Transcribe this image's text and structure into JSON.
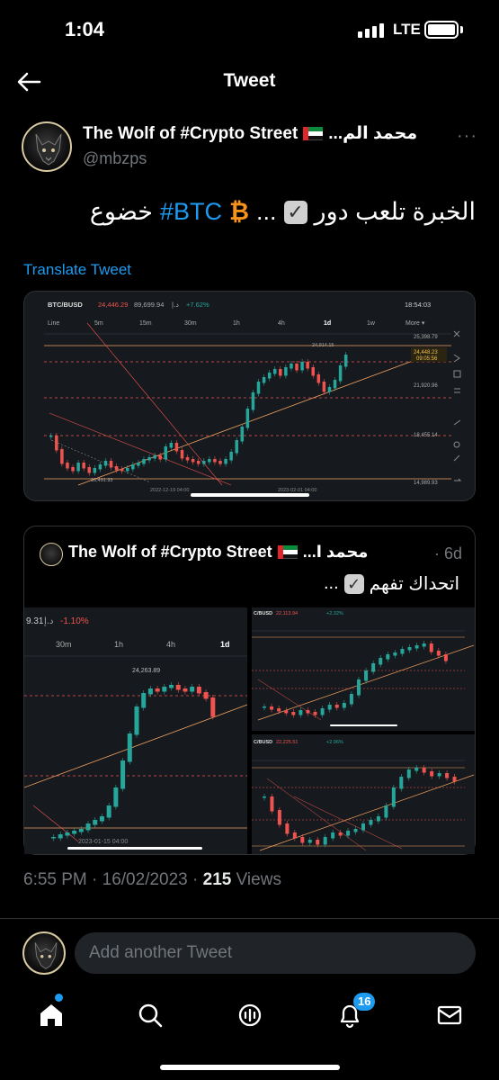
{
  "status_bar": {
    "time": "1:04",
    "network": "LTE"
  },
  "header": {
    "title": "Tweet"
  },
  "tweet": {
    "author_name": "The Wolf of #Crypto Street",
    "author_name_arabic": "محمد الم...",
    "handle": "@mbzps",
    "text_before": "الخبرة تلعب دور",
    "text_ellipsis": "...",
    "hashtag": "#BTC",
    "text_after": "خضوع",
    "translate_label": "Translate Tweet",
    "timestamp": "6:55 PM · 16/02/2023 · ",
    "views_count": "215",
    "views_label": " Views"
  },
  "chart_image": {
    "pair": "BTC/BUSD",
    "price": "24,446.29",
    "volume": "89,699.94",
    "currency": "د.إ",
    "change": "+7.62%",
    "clock": "18:54:03",
    "timeframes": [
      "Line",
      "5m",
      "15m",
      "30m",
      "1h",
      "4h",
      "1d",
      "1w",
      "More ▾"
    ],
    "active_timeframe": "1d",
    "price_levels": [
      "25,398.79",
      "24,448.23",
      "09:05:56",
      "21,920.96",
      "18,455.14",
      "14,989.93"
    ],
    "high_label": "24,914.15",
    "low_label": "16,491.93",
    "date_labels": [
      "2022-12-19 04:00",
      "2023-02-01 04:00"
    ]
  },
  "quote": {
    "author_name": "The Wolf of #Crypto Street",
    "author_name_arabic": "محمد ا...",
    "time": "· 6d",
    "text": "اتحداك تفهم",
    "ellipsis": "...",
    "image1": {
      "price": "9.31",
      "currency": "د.إ",
      "change": "-1.10%",
      "timeframes": [
        "30m",
        "1h",
        "4h",
        "1d"
      ],
      "high_label": "24,263.89",
      "date_label": "2023-01-15 04:00"
    },
    "image2": {
      "pair": "C/BUSD",
      "price": "22,113.94",
      "change": "+2.32%"
    },
    "image3": {
      "pair": "C/BUSD",
      "price": "22,225.51",
      "change": "+2.96%"
    }
  },
  "reply": {
    "placeholder": "Add another Tweet"
  },
  "tabbar": {
    "notifications_badge": "16"
  },
  "colors": {
    "accent": "#1d9bf0",
    "up": "#26a69a",
    "down": "#ef5350",
    "guide": "#f0a060"
  }
}
